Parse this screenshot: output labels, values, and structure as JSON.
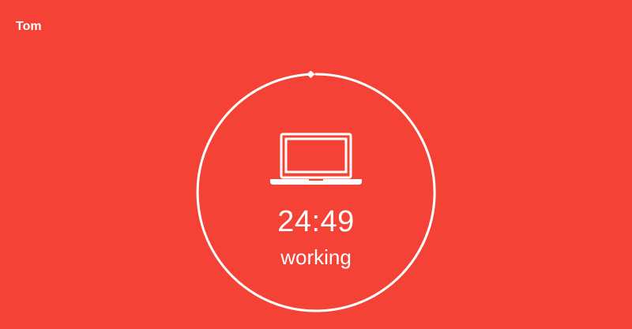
{
  "user": {
    "name": "Tom"
  },
  "timer": {
    "time_remaining": "24:49",
    "status": "working",
    "status_icon": "laptop-icon",
    "progress_fraction": 0.993
  },
  "colors": {
    "background": "#f44336",
    "foreground": "#ffffff"
  }
}
